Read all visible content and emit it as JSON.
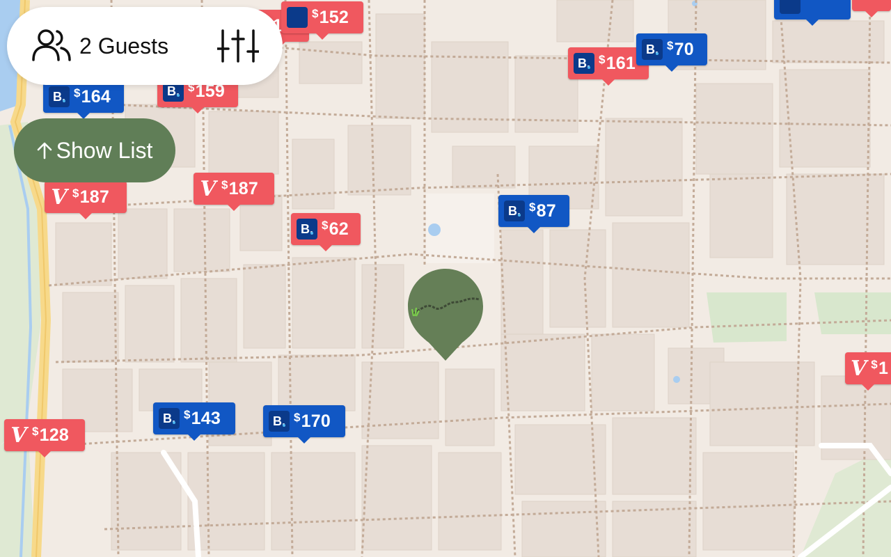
{
  "toolbar": {
    "guests_label": "2 Guests",
    "guests_icon": "users-icon",
    "filter_icon": "sliders-icon"
  },
  "show_list": {
    "label": "Show List",
    "icon": "arrow-up-icon"
  },
  "colors": {
    "vrbo_pin": "#f0585f",
    "booking_pin": "#1157c4",
    "booking_logo": "#0b3a8a",
    "show_list_bg": "#607e57",
    "marker": "#657f57",
    "map_bg": "#f2ebe4",
    "building": "#e7ddd5"
  },
  "listings": [
    {
      "provider": "vrbo",
      "logo": "",
      "price": "170"
    },
    {
      "provider": "vrbo",
      "logo": "",
      "price": "152"
    },
    {
      "provider": "vrbo",
      "logo": "B.",
      "price": "161"
    },
    {
      "provider": "booking",
      "logo": "B.",
      "price": "70"
    },
    {
      "provider": "booking",
      "logo": "B.",
      "price": "164"
    },
    {
      "provider": "vrbo",
      "logo": "B.",
      "price": "159"
    },
    {
      "provider": "vrbo",
      "logo": "V",
      "price": "187"
    },
    {
      "provider": "vrbo",
      "logo": "V",
      "price": "187"
    },
    {
      "provider": "booking",
      "logo": "B.",
      "price": "87"
    },
    {
      "provider": "vrbo",
      "logo": "B.",
      "price": "62"
    },
    {
      "provider": "booking",
      "logo": "B.",
      "price": "143"
    },
    {
      "provider": "booking",
      "logo": "B.",
      "price": "170"
    },
    {
      "provider": "vrbo",
      "logo": "V",
      "price": "128"
    },
    {
      "provider": "vrbo",
      "logo": "V",
      "price": "1"
    }
  ],
  "currency": "$",
  "map": {
    "selected_marker": "location-pin-icon"
  }
}
